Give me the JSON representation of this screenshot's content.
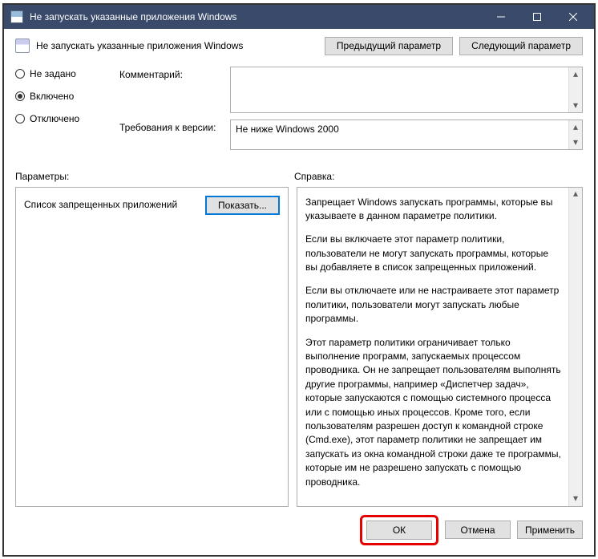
{
  "titlebar": {
    "title": "Не запускать указанные приложения Windows"
  },
  "header": {
    "title": "Не запускать указанные приложения Windows",
    "prev": "Предыдущий параметр",
    "next": "Следующий параметр"
  },
  "radios": {
    "not_configured": "Не задано",
    "enabled": "Включено",
    "disabled": "Отключено"
  },
  "fields": {
    "comment_label": "Комментарий:",
    "comment_value": "",
    "req_label": "Требования к версии:",
    "req_value": "Не ниже Windows 2000"
  },
  "pane_labels": {
    "params": "Параметры:",
    "help": "Справка:"
  },
  "params": {
    "label": "Список запрещенных приложений",
    "show_btn": "Показать..."
  },
  "help": {
    "p1": "Запрещает Windows запускать программы, которые вы указываете в данном параметре политики.",
    "p2": "Если вы включаете этот параметр политики, пользователи не могут запускать программы, которые вы добавляете в список запрещенных приложений.",
    "p3": "Если вы отключаете или не настраиваете этот параметр политики, пользователи могут запускать любые программы.",
    "p4": "Этот параметр политики ограничивает только выполнение программ, запускаемых процессом проводника. Он не запрещает пользователям выполнять другие программы, например «Диспетчер задач», которые запускаются с помощью системного процесса или с помощью иных процессов.  Кроме того, если пользователям разрешен доступ к командной строке (Cmd.exe), этот параметр политики не запрещает им запускать из окна командной строки даже те программы, которые им не разрешено запускать с помощью проводника."
  },
  "buttons": {
    "ok": "ОК",
    "cancel": "Отмена",
    "apply": "Применить"
  }
}
